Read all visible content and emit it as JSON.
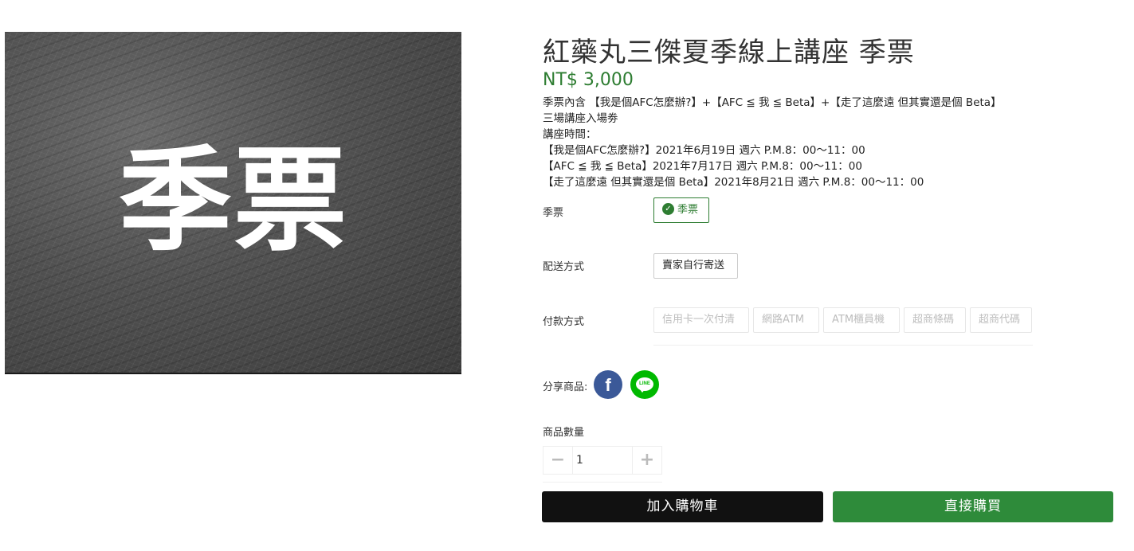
{
  "product": {
    "image_text": "季票",
    "title": "紅藥丸三傑夏季線上講座 季票",
    "price": "NT$ 3,000",
    "description": [
      "季票內含 【我是個AFC怎麼辦?】+【AFC ≦ 我 ≦ Beta】+【走了這麼遠 但其實還是個 Beta】",
      "三場講座入場劵",
      "講座時間：",
      "【我是個AFC怎麼辦?】2021年6月19日 週六 P.M.8：00～11：00",
      "【AFC ≦ 我 ≦ Beta】2021年7月17日 週六 P.M.8：00～11：00",
      "【走了這麼遠 但其實還是個 Beta】2021年8月21日 週六 P.M.8：00～11：00"
    ]
  },
  "variant": {
    "label": "季票",
    "options": [
      {
        "label": "季票",
        "selected": true
      }
    ]
  },
  "shipping": {
    "label": "配送方式",
    "options": [
      {
        "label": "賣家自行寄送"
      }
    ]
  },
  "payment": {
    "label": "付款方式",
    "options": [
      {
        "label": "信用卡一次付清"
      },
      {
        "label": "網路ATM"
      },
      {
        "label": "ATM櫃員機"
      },
      {
        "label": "超商條碼"
      },
      {
        "label": "超商代碼"
      }
    ]
  },
  "share": {
    "label": "分享商品:",
    "facebook_icon": "facebook-icon",
    "line_icon": "line-icon",
    "line_text": "LINE",
    "facebook_text": "f"
  },
  "quantity": {
    "label": "商品數量",
    "value": "1",
    "minus": "−",
    "plus": "+"
  },
  "actions": {
    "add_to_cart": "加入購物車",
    "buy_now": "直接購買"
  },
  "colors": {
    "price": "#2e7d32",
    "buy_button": "#2e8b3a",
    "cart_button": "#111111",
    "facebook": "#3b5998",
    "line": "#00b900"
  }
}
